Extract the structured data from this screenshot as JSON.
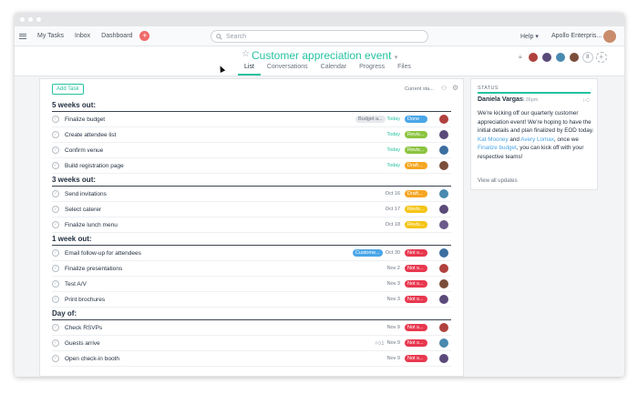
{
  "topbar": {
    "nav": [
      "My Tasks",
      "Inbox",
      "Dashboard"
    ],
    "search_placeholder": "Search",
    "help": "Help",
    "org": "Apollo Enterpris..."
  },
  "project": {
    "title": "Customer appreciation event",
    "tabs": [
      "List",
      "Conversations",
      "Calendar",
      "Progress",
      "Files"
    ],
    "members_extra": "8"
  },
  "toolbar": {
    "add_task": "Add Task",
    "current": "Current sta..."
  },
  "sections": [
    {
      "title": "5 weeks out:",
      "tasks": [
        {
          "name": "Finalize budget",
          "tag": "Budget a...",
          "tag_color": "gray",
          "due": "Today",
          "due_green": true,
          "status": "Done",
          "status_color": "#4aa6e8",
          "avatar": "#b0413e"
        },
        {
          "name": "Create attendee list",
          "tag": "",
          "due": "Today",
          "due_green": true,
          "status": "Revis...",
          "status_color": "#8bc43f",
          "avatar": "#5a4a7a"
        },
        {
          "name": "Confirm venue",
          "tag": "",
          "due": "Today",
          "due_green": true,
          "status": "Revis...",
          "status_color": "#8bc43f",
          "avatar": "#3b6fa0"
        },
        {
          "name": "Build registration page",
          "tag": "",
          "due": "Today",
          "due_green": true,
          "status": "Draft...",
          "status_color": "#f5a623",
          "avatar": "#7a4e3a"
        }
      ]
    },
    {
      "title": "3 weeks out:",
      "tasks": [
        {
          "name": "Send invitations",
          "tag": "",
          "due": "Oct 16",
          "due_green": false,
          "status": "Draft...",
          "status_color": "#f5a623",
          "avatar": "#4a8ab0"
        },
        {
          "name": "Select caterer",
          "tag": "",
          "due": "Oct 17",
          "due_green": false,
          "status": "Revis...",
          "status_color": "#f5c518",
          "avatar": "#5a4a7a"
        },
        {
          "name": "Finalize lunch menu",
          "tag": "",
          "due": "Oct 18",
          "due_green": false,
          "status": "Revis...",
          "status_color": "#f5c518",
          "avatar": "#6b5a8a"
        }
      ]
    },
    {
      "title": "1 week out:",
      "tasks": [
        {
          "name": "Email follow-up for attendees",
          "tag": "Custome...",
          "tag_color": "blue",
          "due": "Oct 30",
          "due_green": false,
          "status": "Not s...",
          "status_color": "#e8384f",
          "avatar": "#3b6fa0"
        },
        {
          "name": "Finalize presentations",
          "tag": "",
          "due": "Nov 2",
          "due_green": false,
          "status": "Not s...",
          "status_color": "#e8384f",
          "avatar": "#b0413e"
        },
        {
          "name": "Test A/V",
          "tag": "",
          "due": "Nov 3",
          "due_green": false,
          "status": "Not s...",
          "status_color": "#e8384f",
          "avatar": "#7a4e3a"
        },
        {
          "name": "Print brochures",
          "tag": "",
          "due": "Nov 3",
          "due_green": false,
          "status": "Not s...",
          "status_color": "#e8384f",
          "avatar": "#5a4a7a"
        }
      ]
    },
    {
      "title": "Day of:",
      "tasks": [
        {
          "name": "Check RSVPs",
          "tag": "",
          "due": "Nov 9",
          "due_green": false,
          "status": "Not s...",
          "status_color": "#e8384f",
          "avatar": "#b0413e"
        },
        {
          "name": "Guests arrive",
          "tag": "",
          "likes": "1",
          "due": "Nov 9",
          "due_green": false,
          "status": "Not s...",
          "status_color": "#e8384f",
          "avatar": "#4a8ab0"
        },
        {
          "name": "Open check-in booth",
          "tag": "",
          "due": "Nov 9",
          "due_green": false,
          "status": "Not s...",
          "status_color": "#e8384f",
          "avatar": "#5a4a7a"
        }
      ]
    }
  ],
  "status_panel": {
    "label": "STATUS",
    "author": "Daniela Vargas",
    "time": "6:36pm",
    "body_1": "We're kicking off our quarterly customer appreciation event! We're hoping to have the initial details and plan finalized by EOD today. ",
    "link_1": "Kat Mooney",
    "body_2": " and ",
    "link_2": "Avery Lomax",
    "body_3": ", once we ",
    "link_3": "Finalize budget",
    "body_4": ", you can kick off with your respective teams!",
    "view_all": "View all updates"
  },
  "colors": {
    "accent": "#25c2a0",
    "link": "#4aa6e8",
    "brand_plus": "#f06a6a"
  }
}
